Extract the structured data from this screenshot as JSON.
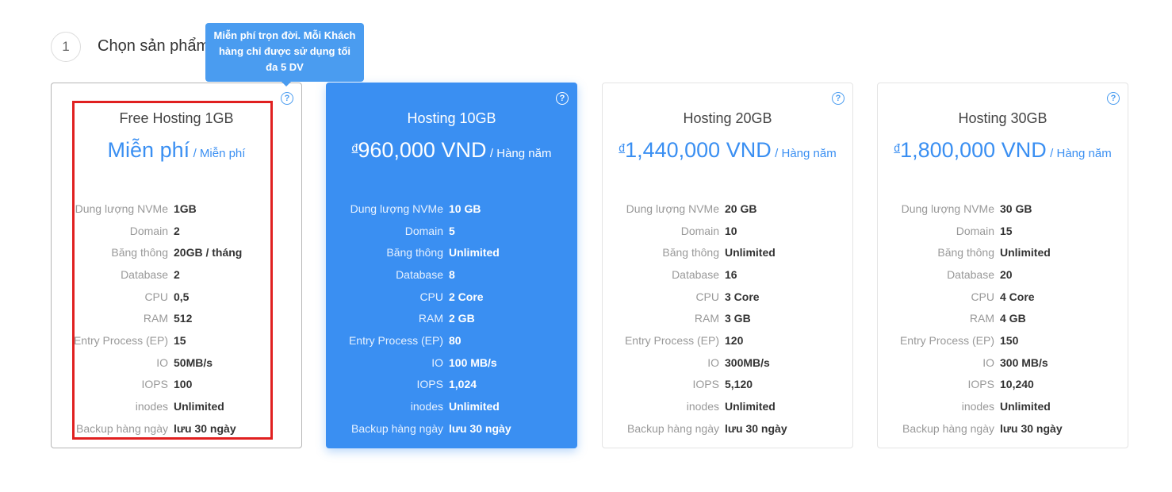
{
  "step": {
    "number": "1",
    "title": "Chọn sản phẩm"
  },
  "tooltip": {
    "text": "Miễn phí trọn đời. Mỗi Khách hàng chỉ được sử dụng tối đa 5 DV"
  },
  "help_icon_glyph": "?",
  "colors": {
    "accent": "#3a8ff2",
    "highlight": "#e02020"
  },
  "plans": [
    {
      "name": "Free Hosting 1GB",
      "currency": "",
      "price": "Miễn phí",
      "period": "/ Miễn phí",
      "specs": [
        {
          "label": "Dung lượng NVMe",
          "value": "1GB"
        },
        {
          "label": "Domain",
          "value": "2"
        },
        {
          "label": "Băng thông",
          "value": "20GB / tháng"
        },
        {
          "label": "Database",
          "value": "2"
        },
        {
          "label": "CPU",
          "value": "0,5"
        },
        {
          "label": "RAM",
          "value": "512"
        },
        {
          "label": "Entry Process (EP)",
          "value": "15"
        },
        {
          "label": "IO",
          "value": "50MB/s"
        },
        {
          "label": "IOPS",
          "value": "100"
        },
        {
          "label": "inodes",
          "value": "Unlimited"
        },
        {
          "label": "Backup hàng ngày",
          "value": "lưu 30 ngày"
        }
      ]
    },
    {
      "name": "Hosting 10GB",
      "currency": "đ",
      "price": "960,000 VND",
      "period": "/ Hàng năm",
      "specs": [
        {
          "label": "Dung lượng NVMe",
          "value": "10 GB"
        },
        {
          "label": "Domain",
          "value": "5"
        },
        {
          "label": "Băng thông",
          "value": "Unlimited"
        },
        {
          "label": "Database",
          "value": "8"
        },
        {
          "label": "CPU",
          "value": "2 Core"
        },
        {
          "label": "RAM",
          "value": "2 GB"
        },
        {
          "label": "Entry Process (EP)",
          "value": "80"
        },
        {
          "label": "IO",
          "value": "100 MB/s"
        },
        {
          "label": "IOPS",
          "value": "1,024"
        },
        {
          "label": "inodes",
          "value": "Unlimited"
        },
        {
          "label": "Backup hàng ngày",
          "value": "lưu 30 ngày"
        }
      ]
    },
    {
      "name": "Hosting 20GB",
      "currency": "đ",
      "price": "1,440,000 VND",
      "period": "/ Hàng năm",
      "specs": [
        {
          "label": "Dung lượng NVMe",
          "value": "20 GB"
        },
        {
          "label": "Domain",
          "value": "10"
        },
        {
          "label": "Băng thông",
          "value": "Unlimited"
        },
        {
          "label": "Database",
          "value": "16"
        },
        {
          "label": "CPU",
          "value": "3 Core"
        },
        {
          "label": "RAM",
          "value": "3 GB"
        },
        {
          "label": "Entry Process (EP)",
          "value": "120"
        },
        {
          "label": "IO",
          "value": "300MB/s"
        },
        {
          "label": "IOPS",
          "value": "5,120"
        },
        {
          "label": "inodes",
          "value": "Unlimited"
        },
        {
          "label": "Backup hàng ngày",
          "value": "lưu 30 ngày"
        }
      ]
    },
    {
      "name": "Hosting 30GB",
      "currency": "đ",
      "price": "1,800,000 VND",
      "period": "/ Hàng năm",
      "specs": [
        {
          "label": "Dung lượng NVMe",
          "value": "30 GB"
        },
        {
          "label": "Domain",
          "value": "15"
        },
        {
          "label": "Băng thông",
          "value": "Unlimited"
        },
        {
          "label": "Database",
          "value": "20"
        },
        {
          "label": "CPU",
          "value": "4 Core"
        },
        {
          "label": "RAM",
          "value": "4 GB"
        },
        {
          "label": "Entry Process (EP)",
          "value": "150"
        },
        {
          "label": "IO",
          "value": "300 MB/s"
        },
        {
          "label": "IOPS",
          "value": "10,240"
        },
        {
          "label": "inodes",
          "value": "Unlimited"
        },
        {
          "label": "Backup hàng ngày",
          "value": "lưu 30 ngày"
        }
      ]
    }
  ]
}
